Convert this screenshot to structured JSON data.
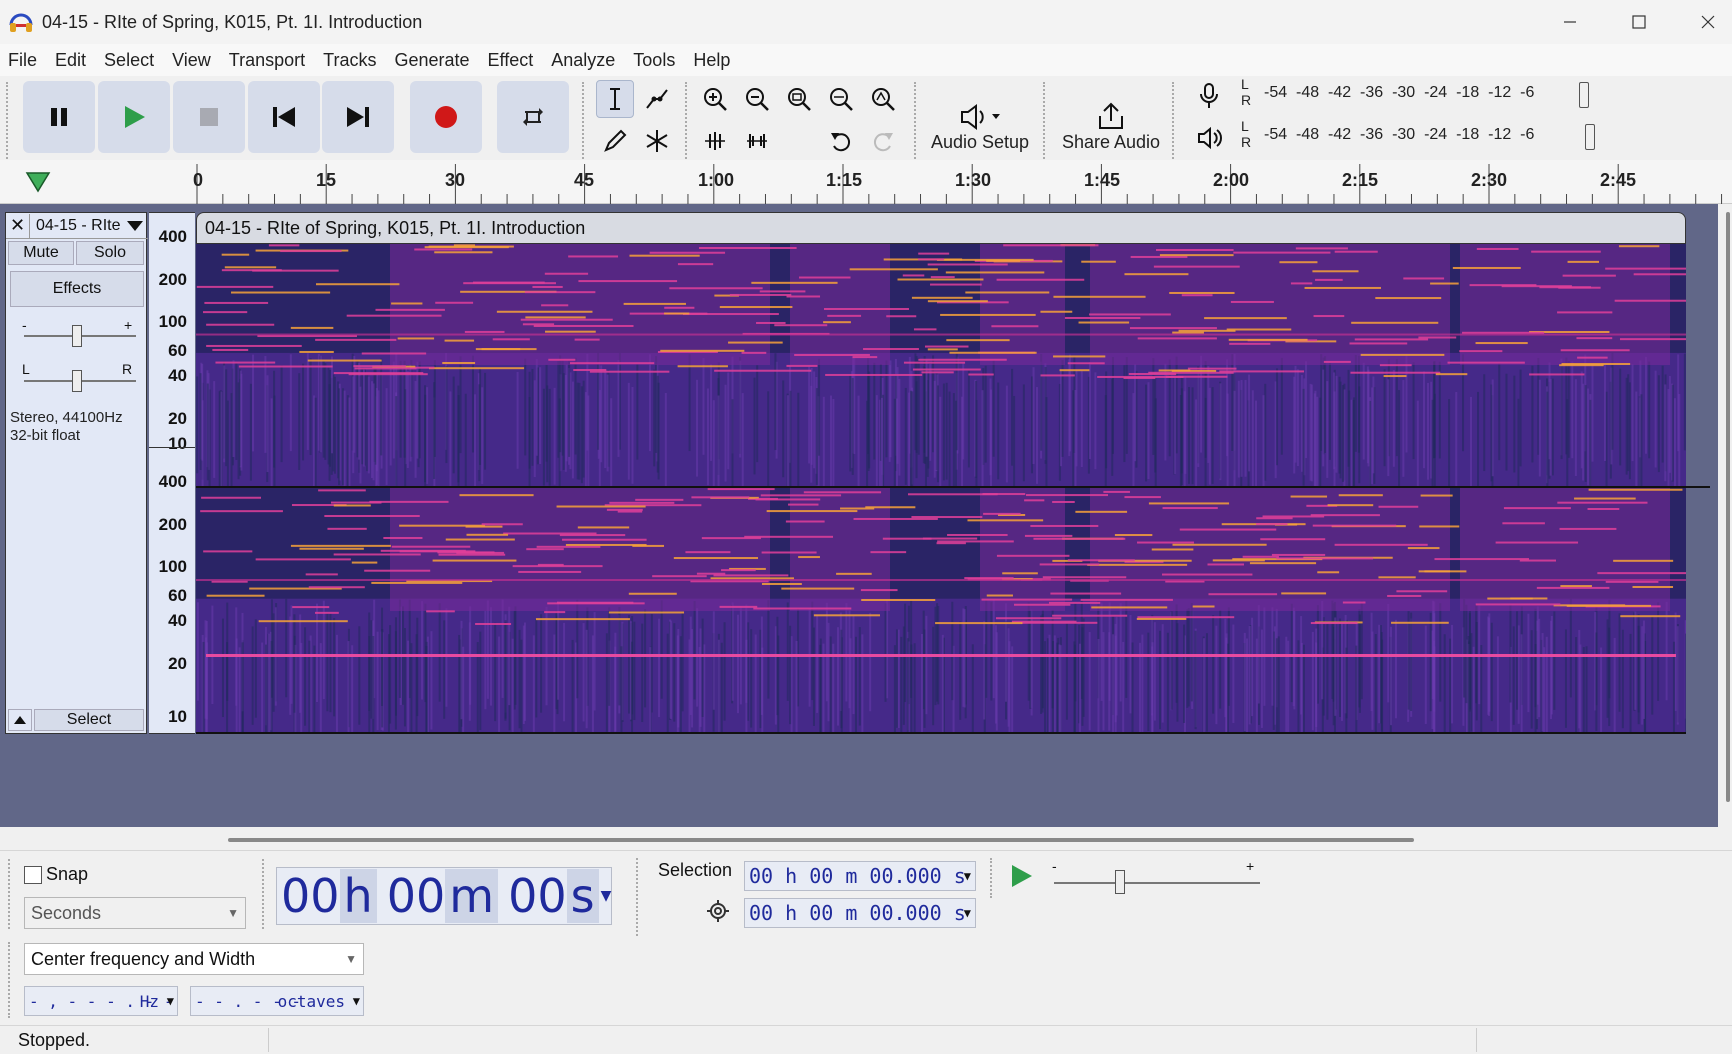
{
  "window": {
    "title": "04-15 - RIte of Spring, K015, Pt. 1I. Introduction",
    "app_icon": "headphones-icon",
    "controls": [
      "minimize-icon",
      "maximize-icon",
      "close-icon"
    ]
  },
  "menu": [
    "File",
    "Edit",
    "Select",
    "View",
    "Transport",
    "Tracks",
    "Generate",
    "Effect",
    "Analyze",
    "Tools",
    "Help"
  ],
  "toolbar": {
    "transport": [
      "pause-icon",
      "play-icon",
      "stop-icon",
      "skip-start-icon",
      "skip-end-icon",
      "record-icon",
      "loop-icon"
    ],
    "audio_setup_label": "Audio Setup",
    "share_audio_label": "Share Audio",
    "meter_scale": "-54  -48  -42  -36  -30  -24  -18  -12  -6",
    "meter_lr": "L\nR"
  },
  "ruler": {
    "labels": [
      "0",
      "15",
      "30",
      "45",
      "1:00",
      "1:15",
      "1:30",
      "1:45",
      "2:00",
      "2:15",
      "2:30",
      "2:45"
    ]
  },
  "track": {
    "name": "04-15 - RIte",
    "mute_label": "Mute",
    "solo_label": "Solo",
    "effects_label": "Effects",
    "gain_minus": "-",
    "gain_plus": "+",
    "pan_left": "L",
    "pan_right": "R",
    "format_line1": "Stereo, 44100Hz",
    "format_line2": "32-bit float",
    "select_label": "Select",
    "clip_title": "04-15 - RIte of Spring, K015, Pt. 1I. Introduction",
    "scale_labels": [
      "400",
      "200",
      "100",
      "60",
      "40",
      "20",
      "10"
    ]
  },
  "bottom": {
    "snap_label": "Snap",
    "snap_checked": false,
    "snap_unit": "Seconds",
    "time_display": {
      "h": "00",
      "hu": "h",
      "m": "00",
      "mu": "m",
      "s": "00",
      "su": "s"
    },
    "selection_label": "Selection",
    "selection_start": "00 h 00 m 00.000 s",
    "selection_end": "00 h 00 m 00.000 s",
    "freq_mode": "Center frequency and Width",
    "freq_value": "- , - - - . - -",
    "freq_unit": "Hz",
    "width_value": "- - . - - -",
    "width_unit": "octaves",
    "speed_minus": "-",
    "speed_plus": "+"
  },
  "status": {
    "text": "Stopped."
  }
}
